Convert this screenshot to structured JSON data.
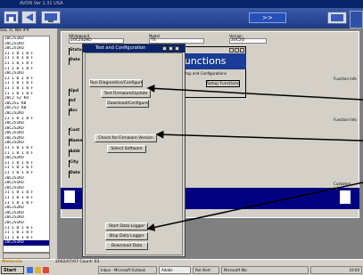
{
  "app": {
    "title": "AVON Ver 1.31 USA"
  },
  "toolbar": {
    "forward_label": ">>"
  },
  "left_panel": {
    "header": "SSL  TC  Nel  ##",
    "items": [
      "20C2S1KO",
      "20C2S1KO",
      "20C2S1KO",
      "J1 1 0 1 0 F",
      "J1 1 0 1 0 F",
      "J1 1 0 1 0 F",
      "J1 1 0 1 0 F",
      "20C2S1KO",
      "J1 1 0 1 0 F",
      "J1 1 0 1 0 F",
      "J1 1 0 1 0 F",
      "J1 1 0 1 0 F",
      "20C2 S2 KU",
      "20C2S1 K0",
      "20C2S2 K0",
      "20C2S2KO",
      "J1 1 0 1 0 F",
      "20C2S1KO",
      "20C2S2KO",
      "20C2S1KO",
      "20C2S2KO",
      "20C2S2KO",
      "J1 1 0 1 0 F",
      "J1 1 0 1 0 F",
      "20C2S2KO",
      "J1 1 0 1 0 F",
      "J1 1 0 1 0 F",
      "J1 1 0 1 0 F",
      "20C2S1KO",
      "20C2S1KO",
      "20C2S1KO",
      "J1 1 0 1 0 F",
      "J1 1 0 1 0 F",
      "J1 1 0 1 0 F",
      "20C2S2KO",
      "20C2S1KO",
      "20C2S2KO",
      "20C2S1KO",
      "J1 1 0 1 0 F",
      "J1 1 0 1 0 F",
      "J1 1 0 1 0 F",
      "20C2S1KO"
    ]
  },
  "record": {
    "serial_label": "Whiteboard",
    "serial_value": "20C2S2KO",
    "model_label": "Model",
    "model_value": "TS",
    "version_label": "Version",
    "version_value": "20C2O",
    "side_labels": [
      "Status",
      "Date"
    ],
    "field_labels": [
      "Upd",
      "Inf",
      "Acc",
      "Cust",
      "Name",
      "Addr",
      "City",
      "Date"
    ],
    "right_labels": [
      "Function Info",
      "Function Info",
      "Customer Info"
    ]
  },
  "functions_dialog": {
    "title": "Functions",
    "subtitle": "Setup and Configurations",
    "button": "Setup Functions"
  },
  "tc_dialog": {
    "title": "Test and Configuration",
    "buttons": [
      "Run Diagnostics/Configure",
      "Test Firmware/Update",
      "Download/Configure",
      "Check for Firmware Version",
      "Select Software",
      "Start Data Logger",
      "Stop Data Logger",
      "Download Data"
    ]
  },
  "status": {
    "brand": "Motorola",
    "text": "2002/07/07  Count: 03"
  },
  "taskbar": {
    "start_label": "Start",
    "tasks": [
      "Inbox - Microsoft Outlook",
      "Adobe",
      "Rel Alert",
      "Microsoft Wo"
    ],
    "clock": "10:00"
  }
}
